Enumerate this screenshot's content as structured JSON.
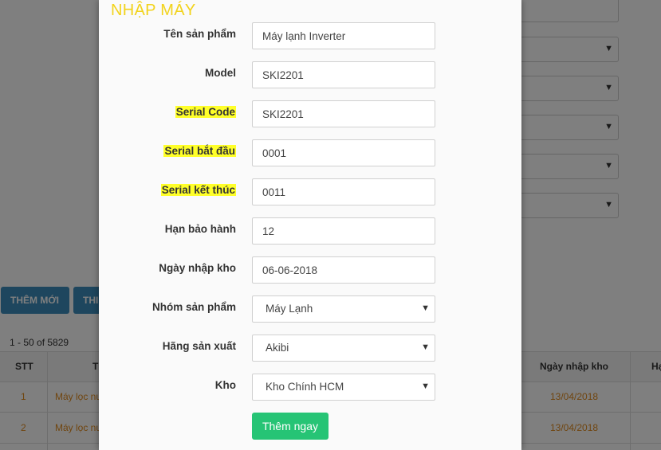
{
  "modal": {
    "title": "NHẬP MÁY",
    "fields": {
      "product_name": {
        "label": "Tên sản phẩm",
        "value": "Máy lạnh Inverter"
      },
      "model": {
        "label": "Model",
        "value": "SKI2201"
      },
      "serial_code": {
        "label": "Serial Code",
        "value": "SKI2201"
      },
      "serial_start": {
        "label": "Serial bắt đầu",
        "value": "0001"
      },
      "serial_end": {
        "label": "Serial kết thúc",
        "value": "0011"
      },
      "warranty": {
        "label": "Hạn bảo hành",
        "value": "12"
      },
      "import_date": {
        "label": "Ngày nhập kho",
        "value": "06-06-2018"
      },
      "product_group": {
        "label": "Nhóm sản phẩm",
        "value": "Máy Lạnh"
      },
      "manufacturer": {
        "label": "Hãng sản xuất",
        "value": "Akibi"
      },
      "warehouse": {
        "label": "Kho",
        "value": "Kho Chính HCM"
      }
    },
    "submit_label": "Thêm ngay",
    "highlight_color": "#ffff29",
    "title_color": "#f2d31b",
    "submit_color": "#26c475"
  },
  "background": {
    "add_new_label": "THÊM MỚI",
    "second_button_label": "THI",
    "range_text": "1 - 50 of 5829",
    "table": {
      "headers": {
        "stt": "STT",
        "name": "T",
        "import_date": "Ngày nhập kho",
        "last": "Hạ"
      },
      "rows": [
        {
          "stt": "1",
          "name": "Máy lọc nư",
          "import_date": "13/04/2018"
        },
        {
          "stt": "2",
          "name": "Máy lọc nư",
          "import_date": "13/04/2018"
        }
      ]
    }
  }
}
